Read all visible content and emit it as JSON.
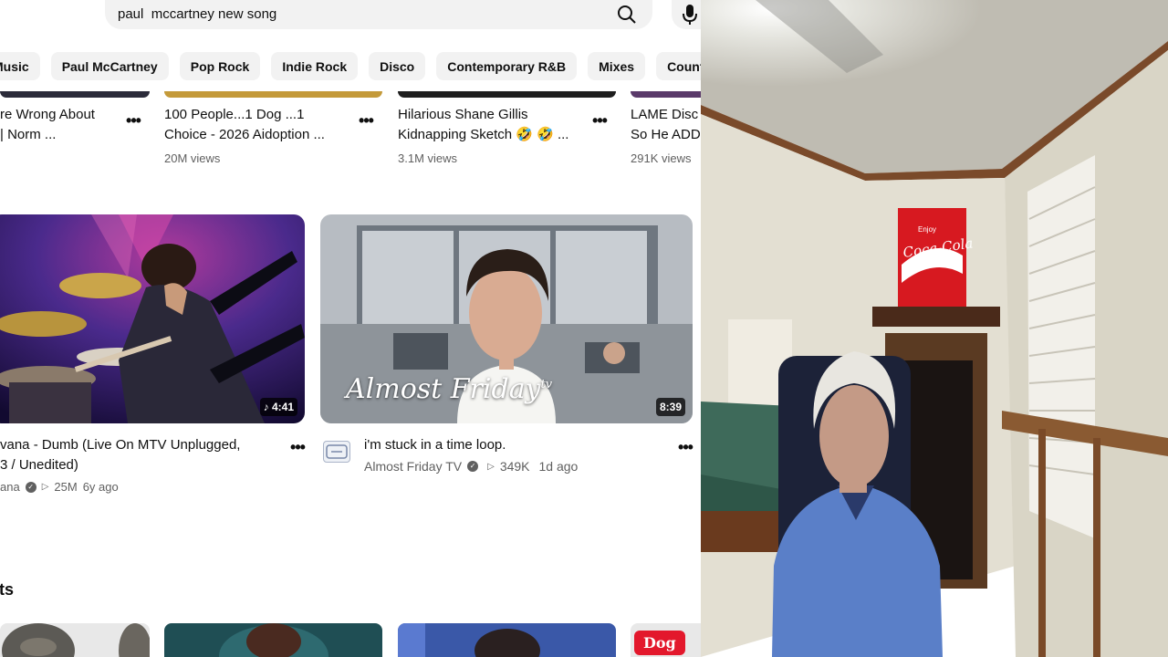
{
  "search": {
    "query": "paul  mccartney new song"
  },
  "chips": [
    "Music",
    "Paul McCartney",
    "Pop Rock",
    "Indie Rock",
    "Disco",
    "Contemporary R&B",
    "Mixes",
    "Country M"
  ],
  "top_videos": [
    {
      "line1": "re Wrong About",
      "line2": "| Norm ...",
      "meta": ""
    },
    {
      "line1": "100 People...1 Dog ...1",
      "line2": "Choice - 2026 Aidoption ...",
      "meta": "20M views"
    },
    {
      "line1": "Hilarious Shane Gillis",
      "line2": "Kidnapping Sketch 🤣 🤣 ...",
      "meta": "3.1M views"
    },
    {
      "line1": "LAME Disc",
      "line2": "So He ADD",
      "meta": "291K views"
    }
  ],
  "videos": [
    {
      "duration": "♪ 4:41",
      "title_line1": "vana - Dumb (Live On MTV Unplugged,",
      "title_line2": "3 / Unedited)",
      "channel": "ana",
      "views": "25M",
      "age": "6y ago"
    },
    {
      "duration": "8:39",
      "overlay": "Almost Friday",
      "overlay_tv": "tv",
      "title_line1": "i'm stuck in a time loop.",
      "channel": "Almost Friday TV",
      "views": "349K",
      "age": "1d ago"
    }
  ],
  "shorts": {
    "label": "rts",
    "card4_text": "Dog"
  },
  "webcam": {
    "sign_line1": "Enjoy",
    "sign_line2": "Coca-Cola"
  },
  "colors": {
    "chip_bg": "#f2f2f2",
    "meta_text": "#606060",
    "coke_red": "#d71920"
  }
}
